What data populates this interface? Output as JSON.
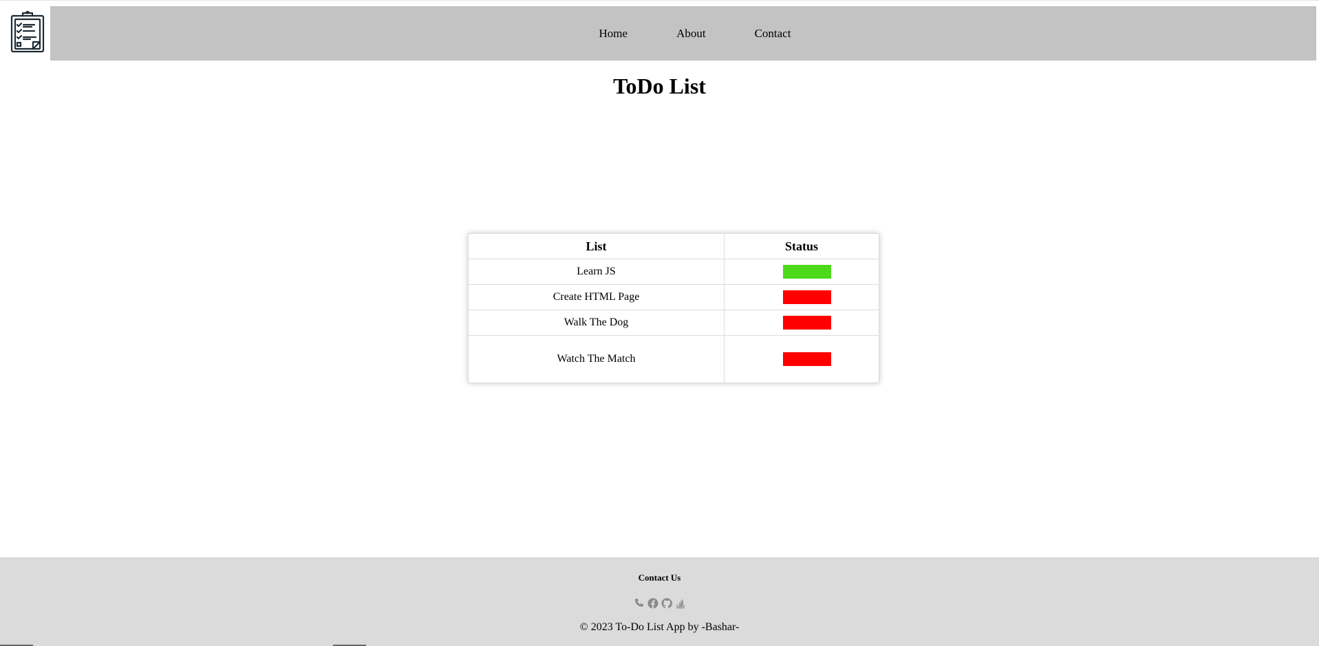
{
  "header": {
    "logo_icon": "clipboard-checklist-icon",
    "nav": [
      {
        "label": "Home"
      },
      {
        "label": "About"
      },
      {
        "label": "Contact"
      }
    ]
  },
  "main": {
    "title": "ToDo List",
    "table": {
      "headers": {
        "list": "List",
        "status": "Status"
      },
      "rows": [
        {
          "task": "Learn JS",
          "status_color": "#4cd91a"
        },
        {
          "task": "Create HTML Page",
          "status_color": "#ff0000"
        },
        {
          "task": "Walk The Dog",
          "status_color": "#ff0000"
        },
        {
          "task": "Watch The Match",
          "status_color": "#ff0000"
        }
      ]
    }
  },
  "footer": {
    "title": "Contact Us",
    "icons": [
      "phone-icon",
      "facebook-icon",
      "github-icon",
      "stackoverflow-icon"
    ],
    "copyright": "© 2023 To-Do List App by -Bashar-"
  },
  "colors": {
    "navbar_bg": "#c4c3c3",
    "footer_bg": "#dbdbdb",
    "done": "#4cd91a",
    "pending": "#ff0000"
  }
}
